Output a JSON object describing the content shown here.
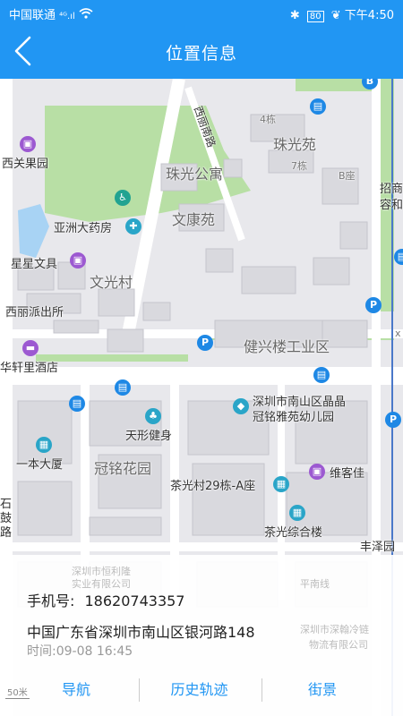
{
  "status": {
    "carrier": "中国联通",
    "signal": "⁴ᴳ.ıl",
    "battery": "80",
    "time": "下午4:50"
  },
  "header": {
    "title": "位置信息"
  },
  "map": {
    "labels": {
      "xili_south": "西丽南路",
      "xiguan_orchard": "西关果园",
      "zhuguang_yuan": "珠光苑",
      "zhuguang_apartment": "珠光公寓",
      "building4": "4栋",
      "building7": "7栋",
      "building_b": "B座",
      "zhaoshang": "招商",
      "rongyuan": "容和",
      "pharmacy": "亚洲大药房",
      "wenkang_yuan": "文康苑",
      "xingxing": "星星文具",
      "wenguang_cun": "文光村",
      "police": "西丽派出所",
      "jianxing": "健兴楼工业区",
      "huaxuanli": "华轩里酒店",
      "jingjing_kg": "深圳市南山区晶晶",
      "guanming_kg": "冠铭雅苑幼儿园",
      "tianxing_gym": "天形健身",
      "yiben": "一本大厦",
      "guanming_garden": "冠铭花园",
      "weikejia": "维客佳",
      "chaguang29": "茶光村29栋-A座",
      "shi": "石",
      "gu": "鼓",
      "lu": "路",
      "chaguang_complex": "茶光综合楼",
      "fengze": "丰泽园",
      "x": "x"
    }
  },
  "card": {
    "phone_label": "手机号:",
    "phone": "18620743357",
    "address": "中国广东省深圳市南山区银河路148",
    "time": "时间:09-08 16:45",
    "ghost1": "深圳市恒利隆",
    "ghost2": "实业有限公司",
    "ghost3": "平南线",
    "ghost4": "深圳市深翰冷链",
    "ghost5": "物流有限公司"
  },
  "scale": "50米",
  "actions": {
    "navigate": "导航",
    "history": "历史轨迹",
    "street_view": "街景"
  },
  "colors": {
    "primary": "#2196f3"
  }
}
